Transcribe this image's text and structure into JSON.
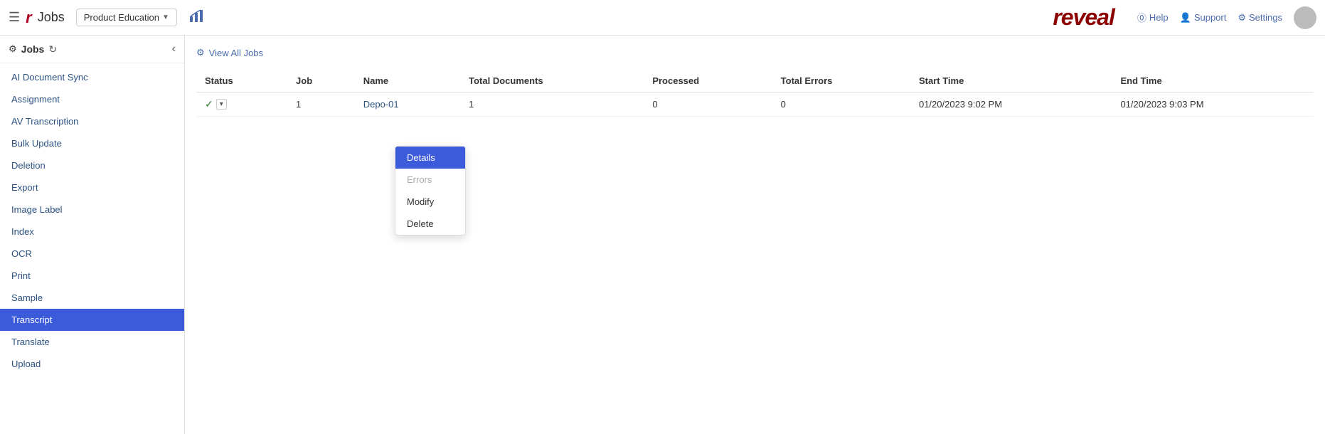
{
  "header": {
    "hamburger_label": "☰",
    "app_logo": "r",
    "app_title": "Jobs",
    "workspace_name": "Product Education",
    "workspace_dropdown_arrow": "▼",
    "chart_icon": "📊",
    "reveal_logo": "reveal",
    "help_label": "Help",
    "support_label": "Support",
    "settings_label": "Settings",
    "help_icon": "?",
    "support_icon": "👤",
    "settings_icon": "⚙"
  },
  "sidebar": {
    "title": "Jobs",
    "refresh_icon": "↻",
    "collapse_icon": "‹",
    "items": [
      {
        "id": "ai-document-sync",
        "label": "AI Document Sync",
        "active": false
      },
      {
        "id": "assignment",
        "label": "Assignment",
        "active": false
      },
      {
        "id": "av-transcription",
        "label": "AV Transcription",
        "active": false
      },
      {
        "id": "bulk-update",
        "label": "Bulk Update",
        "active": false
      },
      {
        "id": "deletion",
        "label": "Deletion",
        "active": false
      },
      {
        "id": "export",
        "label": "Export",
        "active": false
      },
      {
        "id": "image-label",
        "label": "Image Label",
        "active": false
      },
      {
        "id": "index",
        "label": "Index",
        "active": false
      },
      {
        "id": "ocr",
        "label": "OCR",
        "active": false
      },
      {
        "id": "print",
        "label": "Print",
        "active": false
      },
      {
        "id": "sample",
        "label": "Sample",
        "active": false
      },
      {
        "id": "transcript",
        "label": "Transcript",
        "active": true
      },
      {
        "id": "translate",
        "label": "Translate",
        "active": false
      },
      {
        "id": "upload",
        "label": "Upload",
        "active": false
      }
    ]
  },
  "content": {
    "view_all_jobs_label": "View All Jobs",
    "view_all_jobs_icon": "⚙",
    "table": {
      "columns": [
        "Status",
        "Job",
        "Name",
        "Total Documents",
        "Processed",
        "Total Errors",
        "Start Time",
        "End Time"
      ],
      "rows": [
        {
          "status_check": "✓",
          "job_number": "1",
          "name": "Depo-01",
          "total_documents": "1",
          "processed": "0",
          "total_errors": "0",
          "start_time": "01/20/2023 9:02 PM",
          "end_time": "01/20/2023 9:03 PM"
        }
      ]
    }
  },
  "dropdown_menu": {
    "items": [
      {
        "id": "details",
        "label": "Details",
        "active": true,
        "disabled": false
      },
      {
        "id": "errors",
        "label": "Errors",
        "active": false,
        "disabled": true
      },
      {
        "id": "modify",
        "label": "Modify",
        "active": false,
        "disabled": false
      },
      {
        "id": "delete",
        "label": "Delete",
        "active": false,
        "disabled": false
      }
    ]
  }
}
